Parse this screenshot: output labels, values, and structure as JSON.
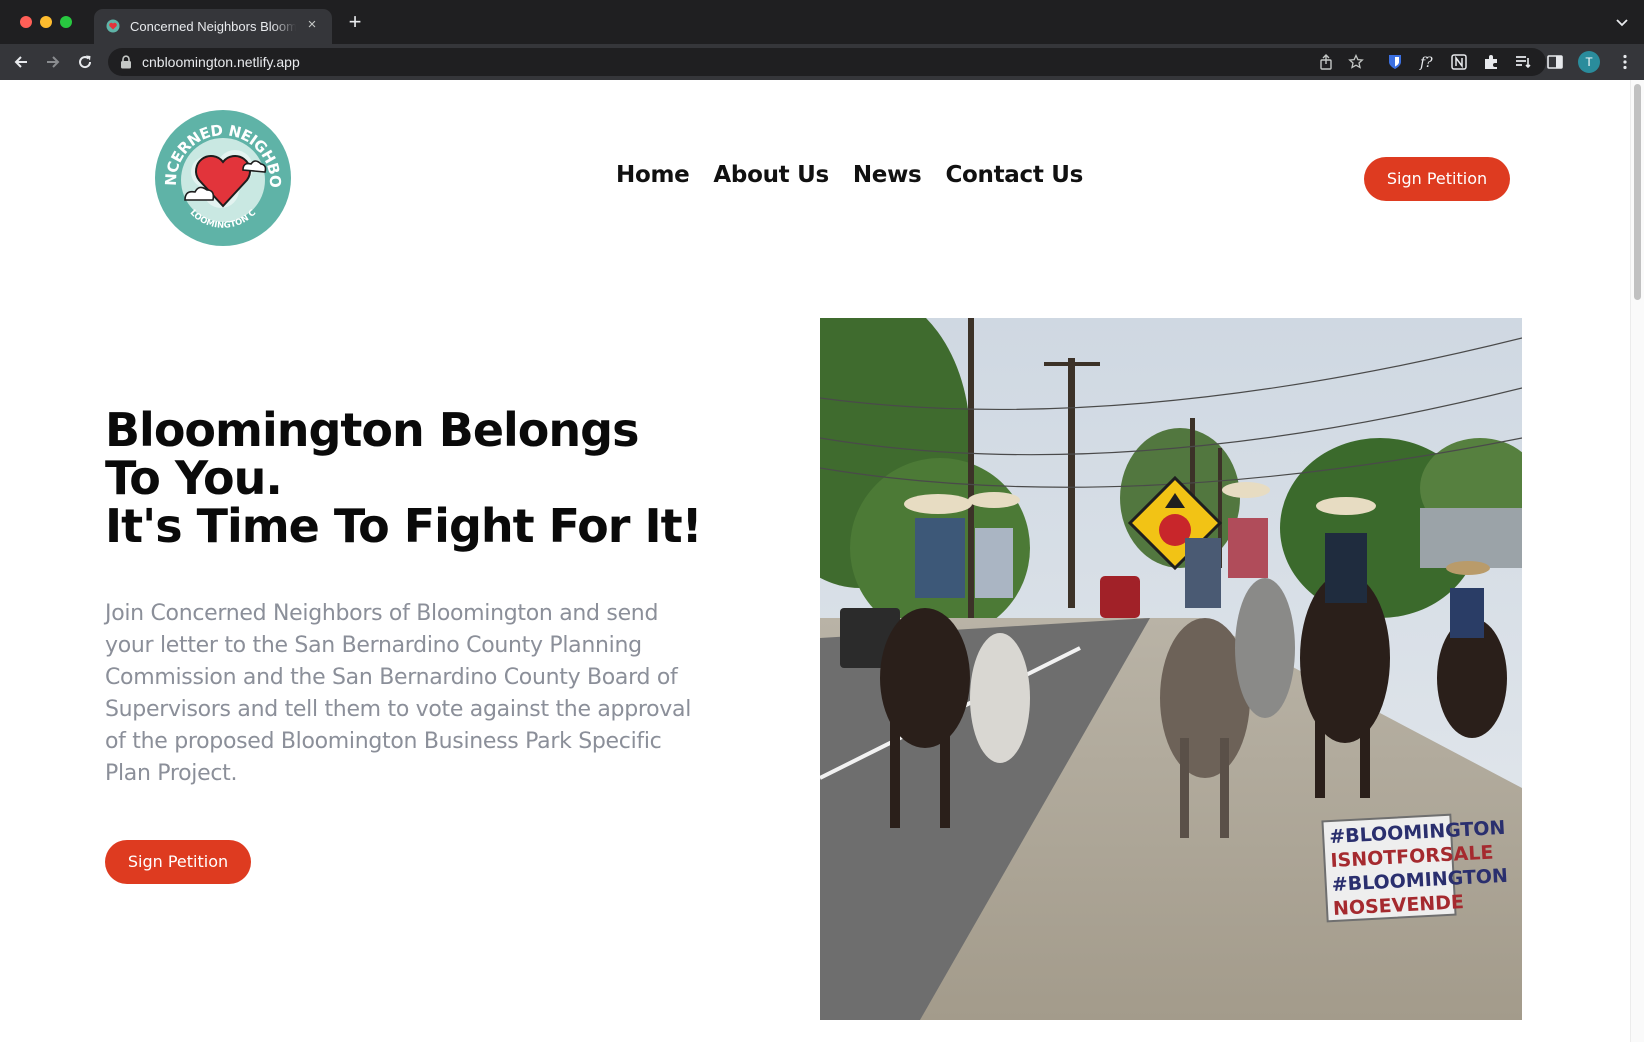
{
  "browser": {
    "tab_title": "Concerned Neighbors Blooming",
    "tab_close": "×",
    "new_tab": "+",
    "url": "cnbloomington.netlify.app",
    "profile_initial": "T"
  },
  "logo": {
    "top_text": "CONCERNED NEIGHBORS",
    "bottom_text": "BLOOMINGTON CA",
    "colors": {
      "teal": "#5fb3a7",
      "heart": "#e2343b",
      "cloud": "#ffffff"
    }
  },
  "nav": {
    "links": [
      "Home",
      "About Us",
      "News",
      "Contact Us"
    ],
    "cta": "Sign Petition"
  },
  "hero": {
    "title_lines": [
      "Bloomington Belongs",
      "To You.",
      "It's Time To Fight For It!"
    ],
    "body": "Join Concerned Neighbors of Bloomington and send your letter to the San Bernardino County Planning Commission and the San Bernardino County Board of Supervisors and tell them to vote against the approval of the proposed Bloomington Business Park Specific Plan Project.",
    "cta": "Sign Petition",
    "photo_sign_lines": [
      "#BLOOMINGTON",
      "ISNOTFORSALE",
      "#BLOOMINGTON",
      "NOSEVENDE"
    ]
  },
  "colors": {
    "accent": "#de3b20",
    "body_text": "#8b8f99",
    "heading": "#0a0a0a"
  }
}
